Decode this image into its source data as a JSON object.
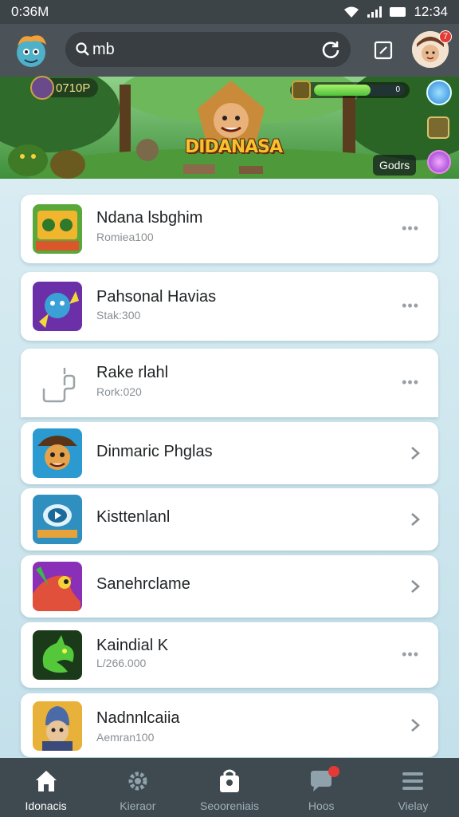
{
  "status_bar": {
    "time": "0:36M",
    "clock": "12:34"
  },
  "search": {
    "query": "mb",
    "search_prefix": "S"
  },
  "avatar": {
    "badge_count": "7"
  },
  "banner": {
    "title": "DIDANASA",
    "coins": "0710P",
    "progress": 0.62,
    "progress_text": "0",
    "goods_label": "Godrs"
  },
  "items": [
    {
      "title": "Ndana lsbghim",
      "subtitle": "Romiea100",
      "action": "more",
      "icon": "jungle-game-icon"
    },
    {
      "title": "Pahsonal Havias",
      "subtitle": "Stak:300",
      "action": "more",
      "icon": "monkey-hero-icon"
    },
    {
      "title": "Rake rlahl",
      "subtitle": "Rork:020",
      "action": "more",
      "icon": "placeholder-outline-icon"
    },
    {
      "title": "Dinmaric Phglas",
      "subtitle": "",
      "action": "chevron",
      "icon": "explorer-hat-icon"
    },
    {
      "title": "Kisttenlanl",
      "subtitle": "",
      "action": "chevron",
      "icon": "play-video-icon"
    },
    {
      "title": "Sanehrclame",
      "subtitle": "",
      "action": "chevron",
      "icon": "colorful-dragon-icon"
    },
    {
      "title": "Kaindial K",
      "subtitle": "L/266.000",
      "action": "more",
      "icon": "green-dragon-icon"
    },
    {
      "title": "Nadnnlcaiia",
      "subtitle": "Aemran100",
      "action": "chevron",
      "icon": "knight-helmet-icon"
    }
  ],
  "bottom_nav": [
    {
      "label": "Idonacis",
      "icon": "home-icon",
      "active": true
    },
    {
      "label": "Kieraor",
      "icon": "gear-icon",
      "active": false
    },
    {
      "label": "Seooreniais",
      "icon": "shopping-bag-icon",
      "active": false
    },
    {
      "label": "Hoos",
      "icon": "chat-bubble-icon",
      "active": false,
      "badge": true
    },
    {
      "label": "Vielay",
      "icon": "menu-icon",
      "active": false
    }
  ],
  "colors": {
    "accent": "#e53935",
    "app_bar": "#4b5358",
    "nav_bar": "#3f4a50",
    "list_bg": "#cfe6ee"
  }
}
